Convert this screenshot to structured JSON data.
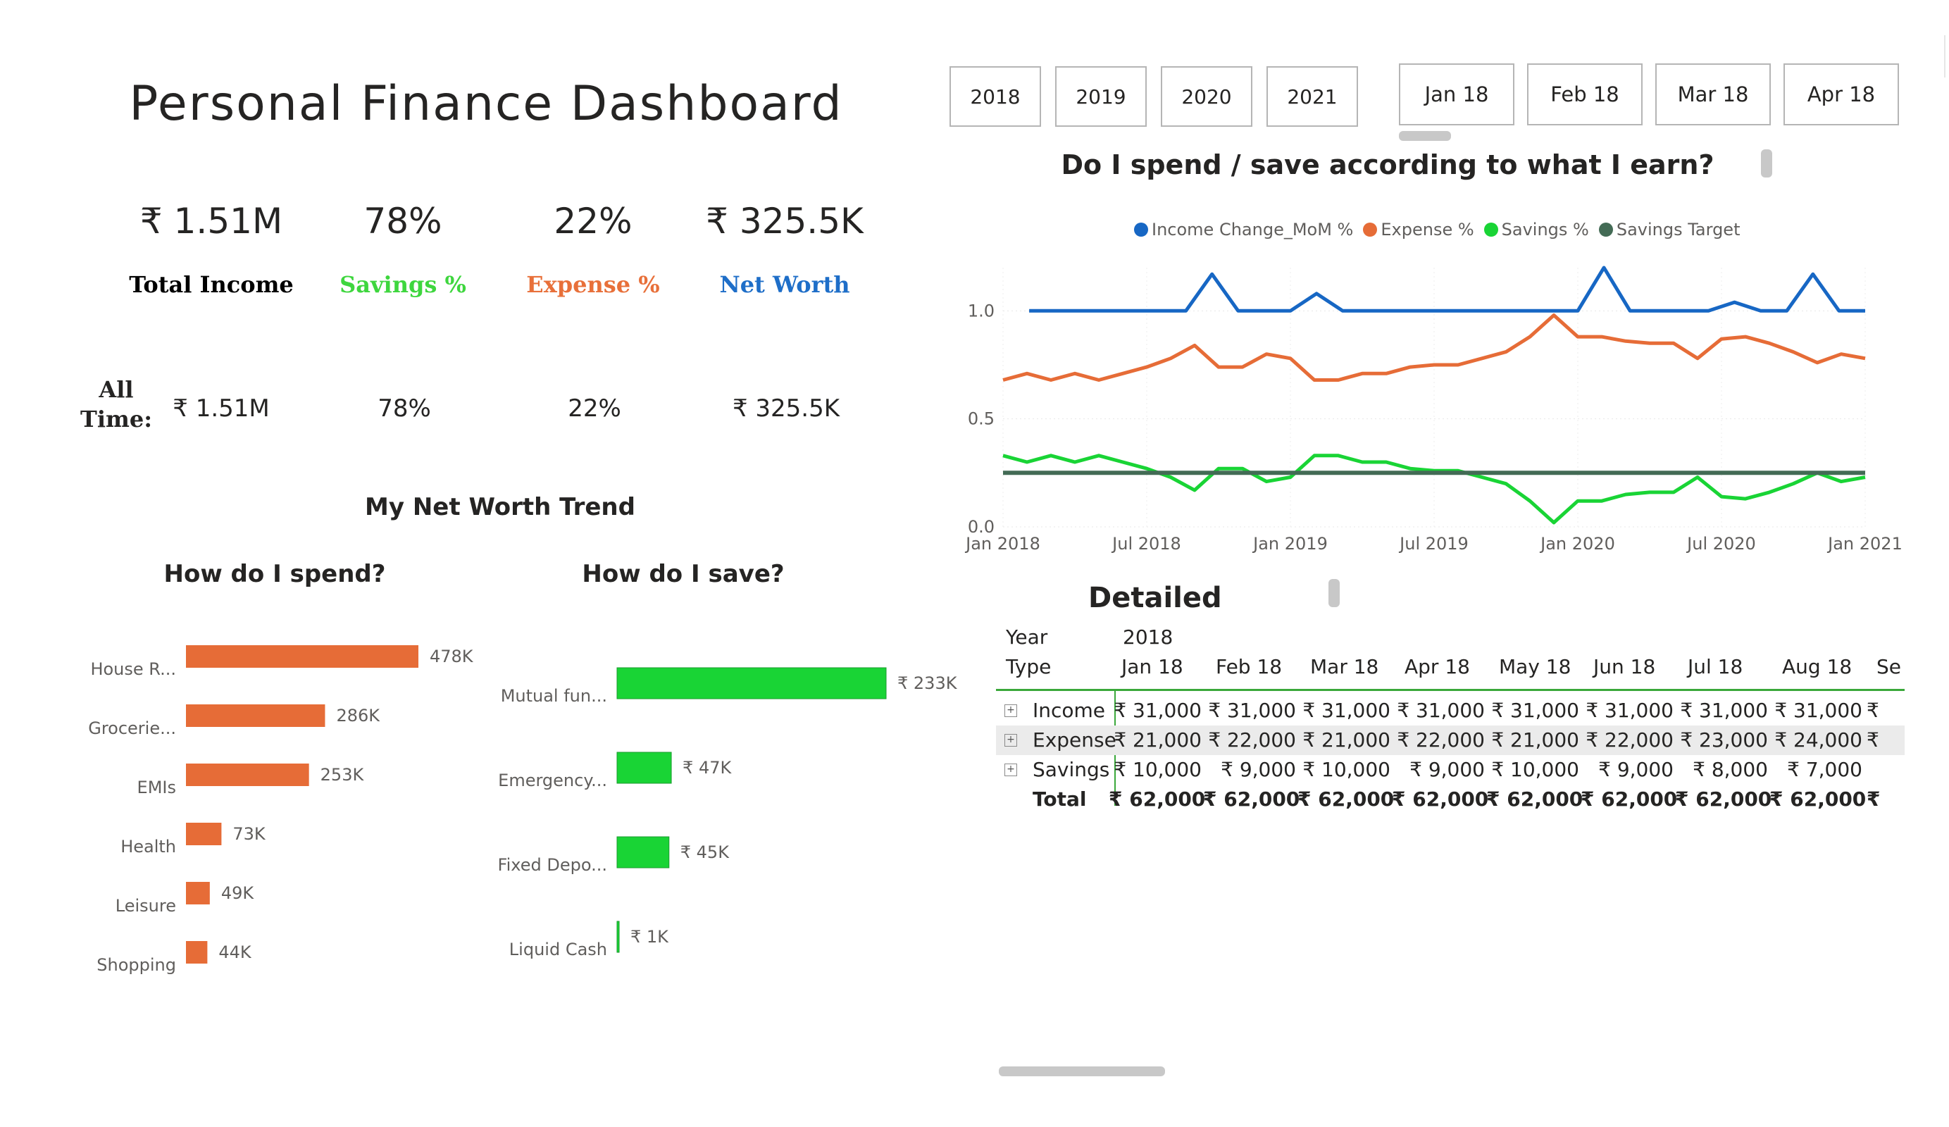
{
  "title": "Personal Finance Dashboard",
  "kpis": [
    {
      "value": "₹ 1.51M",
      "label": "Total Income",
      "color": "#000000"
    },
    {
      "value": "78%",
      "label": "Savings %",
      "color": "#3ed63e"
    },
    {
      "value": "22%",
      "label": "Expense %",
      "color": "#e8703a"
    },
    {
      "value": "₹ 325.5K",
      "label": "Net Worth",
      "color": "#1e6ec8"
    }
  ],
  "all_time": {
    "label": "All Time:",
    "values": [
      "₹ 1.51M",
      "78%",
      "22%",
      "₹ 325.5K"
    ]
  },
  "net_worth_trend_title": "My Net Worth Trend",
  "year_slicer": [
    "2018",
    "2019",
    "2020",
    "2021"
  ],
  "month_slicer": [
    "Jan 18",
    "Feb 18",
    "Mar 18",
    "Apr 18"
  ],
  "colors": {
    "income": "#1767c4",
    "expense": "#e66c37",
    "savings": "#19d435",
    "target": "#436b55",
    "spend_bar": "#e66c37",
    "save_bar": "#19d435"
  },
  "chart_data": [
    {
      "type": "line",
      "title": "Do I spend / save according to what I earn?",
      "legend_position": "top-center",
      "grid": true,
      "x_tick_labels": [
        "Jan 2018",
        "Jul 2018",
        "Jan 2019",
        "Jul 2019",
        "Jan 2020",
        "Jul 2020",
        "Jan 2021"
      ],
      "y_tick_labels": [
        "1.0",
        "0.5",
        "0.0"
      ],
      "ylim": [
        0,
        1.2
      ],
      "series": [
        {
          "name": "Income Change_MoM %",
          "x_start": "Jan 2018",
          "values": [
            null,
            1.0,
            1.0,
            1.0,
            1.0,
            1.0,
            1.0,
            1.0,
            1.17,
            1.0,
            1.0,
            1.0,
            1.08,
            1.0,
            1.0,
            1.0,
            1.0,
            1.0,
            1.0,
            1.0,
            1.0,
            1.0,
            1.0,
            1.2,
            1.0,
            1.0,
            1.0,
            1.0,
            1.04,
            1.0,
            1.0,
            1.17,
            1.0,
            1.0
          ]
        },
        {
          "name": "Expense %",
          "x_start": "Jan 2018",
          "values": [
            0.68,
            0.71,
            0.68,
            0.71,
            0.68,
            0.71,
            0.74,
            0.78,
            0.84,
            0.74,
            0.74,
            0.8,
            0.78,
            0.68,
            0.68,
            0.71,
            0.71,
            0.74,
            0.75,
            0.75,
            0.78,
            0.81,
            0.88,
            0.98,
            0.88,
            0.88,
            0.86,
            0.85,
            0.85,
            0.78,
            0.87,
            0.88,
            0.85,
            0.81,
            0.76,
            0.8,
            0.78
          ]
        },
        {
          "name": "Savings %",
          "x_start": "Jan 2018",
          "values": [
            0.33,
            0.3,
            0.33,
            0.3,
            0.33,
            0.3,
            0.27,
            0.23,
            0.17,
            0.27,
            0.27,
            0.21,
            0.23,
            0.33,
            0.33,
            0.3,
            0.3,
            0.27,
            0.26,
            0.26,
            0.23,
            0.2,
            0.12,
            0.02,
            0.12,
            0.12,
            0.15,
            0.16,
            0.16,
            0.23,
            0.14,
            0.13,
            0.16,
            0.2,
            0.25,
            0.21,
            0.23
          ]
        },
        {
          "name": "Savings Target",
          "x_start": "Jan 2018",
          "values": [
            0.25,
            0.25,
            0.25,
            0.25,
            0.25,
            0.25,
            0.25,
            0.25,
            0.25,
            0.25,
            0.25,
            0.25,
            0.25,
            0.25,
            0.25,
            0.25,
            0.25,
            0.25,
            0.25,
            0.25,
            0.25,
            0.25,
            0.25,
            0.25,
            0.25,
            0.25,
            0.25,
            0.25,
            0.25,
            0.25,
            0.25,
            0.25,
            0.25,
            0.25,
            0.25,
            0.25,
            0.25
          ]
        }
      ]
    },
    {
      "type": "bar",
      "orientation": "horizontal",
      "title": "How do I spend?",
      "categories": [
        "House R...",
        "Grocerie...",
        "EMIs",
        "Health",
        "Leisure",
        "Shopping"
      ],
      "values": [
        478,
        286,
        253,
        73,
        49,
        44
      ],
      "value_labels": [
        "478K",
        "286K",
        "253K",
        "73K",
        "49K",
        "44K"
      ]
    },
    {
      "type": "bar",
      "orientation": "horizontal",
      "title": "How do I save?",
      "categories": [
        "Mutual fun...",
        "Emergency...",
        "Fixed Depo...",
        "Liquid Cash"
      ],
      "values": [
        233,
        47,
        45,
        1
      ],
      "value_labels": [
        "₹ 233K",
        "₹ 47K",
        "₹ 45K",
        "₹ 1K"
      ]
    }
  ],
  "matrix": {
    "title": "Detailed",
    "header_year_label": "Year",
    "header_year_value": "2018",
    "header_type_label": "Type",
    "months": [
      "Jan 18",
      "Feb 18",
      "Mar 18",
      "Apr 18",
      "May 18",
      "Jun 18",
      "Jul 18",
      "Aug 18",
      "Se"
    ],
    "expand_icon": "plus-box-icon",
    "rows": [
      {
        "label": "Income",
        "values": [
          "₹ 31,000",
          "₹ 31,000",
          "₹ 31,000",
          "₹ 31,000",
          "₹ 31,000",
          "₹ 31,000",
          "₹ 31,000",
          "₹ 31,000",
          "₹"
        ]
      },
      {
        "label": "Expense",
        "values": [
          "₹ 21,000",
          "₹ 22,000",
          "₹ 21,000",
          "₹ 22,000",
          "₹ 21,000",
          "₹ 22,000",
          "₹ 23,000",
          "₹ 24,000",
          "₹"
        ]
      },
      {
        "label": "Savings",
        "values": [
          "₹ 10,000",
          "₹ 9,000",
          "₹ 10,000",
          "₹ 9,000",
          "₹ 10,000",
          "₹ 9,000",
          "₹ 8,000",
          "₹ 7,000",
          ""
        ]
      }
    ],
    "total": {
      "label": "Total",
      "values": [
        "₹ 62,000",
        "₹ 62,000",
        "₹ 62,000",
        "₹ 62,000",
        "₹ 62,000",
        "₹ 62,000",
        "₹ 62,000",
        "₹ 62,000",
        "₹"
      ]
    }
  }
}
